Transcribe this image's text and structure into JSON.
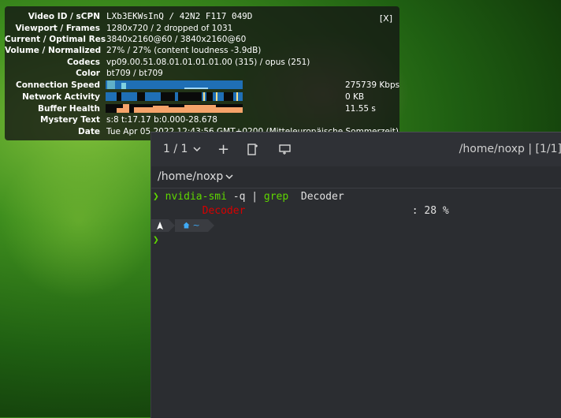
{
  "stats": {
    "close_label": "[X]",
    "rows": [
      {
        "label": "Video ID / sCPN",
        "value": "LXb3EKWsInQ / 42N2 F117 049D"
      },
      {
        "label": "Viewport / Frames",
        "value": "1280x720 / 2 dropped of 1031"
      },
      {
        "label": "Current / Optimal Res",
        "value": "3840x2160@60 / 3840x2160@60"
      },
      {
        "label": "Volume / Normalized",
        "value": "27% / 27% (content loudness -3.9dB)"
      },
      {
        "label": "Codecs",
        "value": "vp09.00.51.08.01.01.01.01.00 (315) / opus (251)"
      },
      {
        "label": "Color",
        "value": "bt709 / bt709"
      },
      {
        "label": "Connection Speed",
        "value": "275739 Kbps"
      },
      {
        "label": "Network Activity",
        "value": "0 KB"
      },
      {
        "label": "Buffer Health",
        "value": "11.55 s"
      },
      {
        "label": "Mystery Text",
        "value": "s:8 t:17.17 b:0.000-28.678"
      },
      {
        "label": "Date",
        "value": "Tue Apr 05 2022 12:43:56 GMT+0200 (Mitteleuropäische Sommerzeit)"
      }
    ],
    "colors": {
      "connection": "#1f6fb5",
      "network": "#1f6fb5",
      "buffer": "#f5a36a"
    }
  },
  "terminal": {
    "toolbar": {
      "tab_counter": "1 / 1",
      "chevron": "⌄",
      "new_tab": "+",
      "path_title": "/home/noxp | [1/1]"
    },
    "tab_label": "/home/noxp",
    "lines": {
      "prompt_symbol": "❯",
      "cmd": "nvidia-smi",
      "arg": " -q | ",
      "grep": "grep",
      "grep_arg": "  Decoder",
      "out_key": "Decoder",
      "out_val": ": 28 %",
      "prompt_home": "~"
    },
    "colors": {
      "bg": "#2b2d31",
      "green": "#5fd700",
      "red": "#d70000",
      "home": "#3fa9f5"
    }
  }
}
